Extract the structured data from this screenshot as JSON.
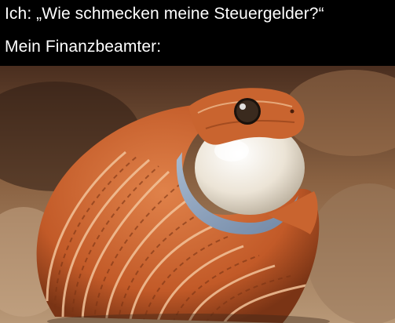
{
  "caption": {
    "line1": "Ich: „Wie schmecken meine Steuergelder?“",
    "line2": "Mein Finanzbeamter:"
  },
  "photo": {
    "subject": "snake-swallowing-egg",
    "colors": {
      "background": "#6b4a33",
      "snake_orange": "#c9642f",
      "snake_stripe": "#f2c49a",
      "inner_skin": "#8fa7c4",
      "egg": "#efe8dc"
    }
  }
}
